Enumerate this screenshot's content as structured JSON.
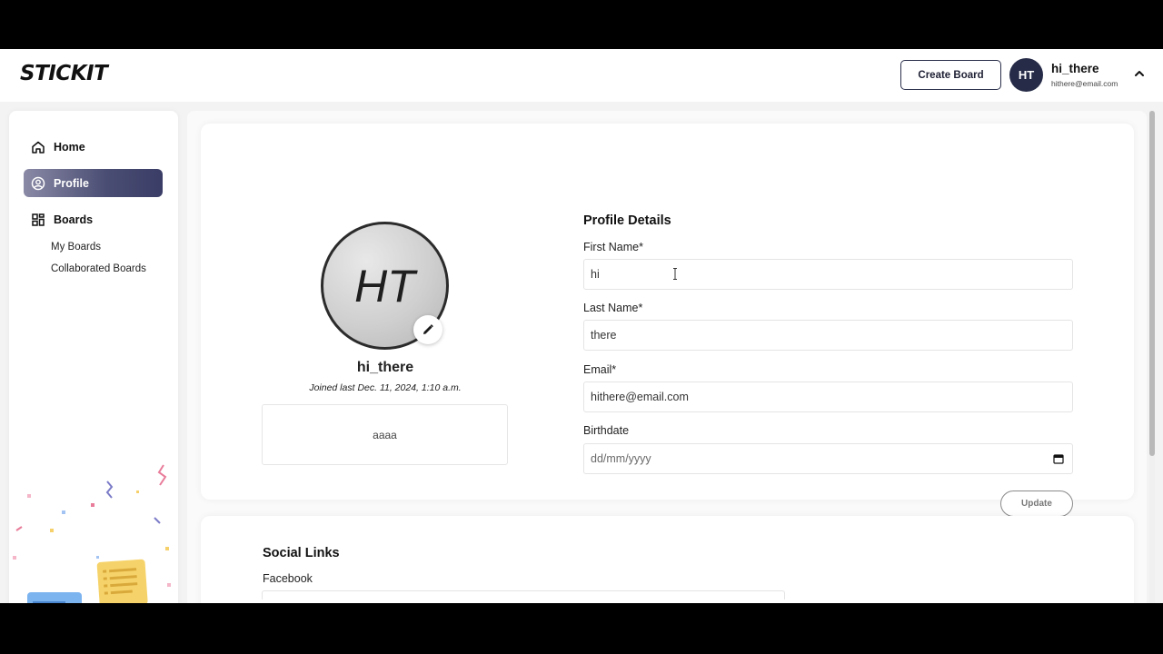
{
  "app": {
    "logo": "STICKIT"
  },
  "header": {
    "create_board_label": "Create Board",
    "avatar_initials": "HT",
    "user_name": "hi_there",
    "user_email": "hithere@email.com"
  },
  "sidebar": {
    "items": [
      {
        "label": "Home",
        "icon": "home-icon",
        "active": false
      },
      {
        "label": "Profile",
        "icon": "user-circle-icon",
        "active": true
      },
      {
        "label": "Boards",
        "icon": "grid-icon",
        "active": false
      }
    ],
    "sub_items": [
      "My Boards",
      "Collaborated Boards"
    ]
  },
  "profile": {
    "avatar_initials": "HT",
    "username": "hi_there",
    "joined": "Joined last Dec. 11, 2024, 1:10 a.m.",
    "bio": "aaaa"
  },
  "details": {
    "title": "Profile Details",
    "first_name_label": "First Name*",
    "first_name_value": "hi",
    "last_name_label": "Last Name*",
    "last_name_value": "there",
    "email_label": "Email*",
    "email_value": "hithere@email.com",
    "birthdate_label": "Birthdate",
    "birthdate_placeholder": "dd/mm/yyyy",
    "update_label": "Update"
  },
  "social": {
    "title": "Social Links",
    "facebook_label": "Facebook"
  },
  "colors": {
    "accent": "#262b47",
    "active_nav_start": "#8a8aa6",
    "active_nav_end": "#3a3d66"
  }
}
